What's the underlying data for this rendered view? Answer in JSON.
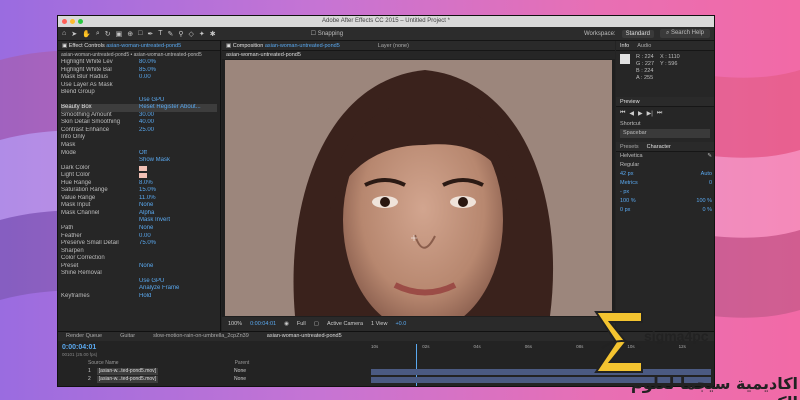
{
  "window": {
    "title": "Adobe After Effects CC 2015 – Untitled Project *"
  },
  "toolbar": {
    "snapping_label": "Snapping",
    "workspace_label": "Workspace:",
    "workspace_value": "Standard",
    "search_placeholder": "Search Help"
  },
  "effect_controls": {
    "tab_title": "Effect Controls",
    "tab_layer": "asian-woman-untreated-pond5",
    "subtitle": "asian-woman-untreated-pond5 • asian-woman-untreated-pond5",
    "rows": [
      {
        "label": "Highlight White Lev",
        "value": "80.0%"
      },
      {
        "label": "Highlight White Bal",
        "value": "85.0%"
      },
      {
        "label": "Mask Blur Radius",
        "value": "0.00"
      },
      {
        "label": "Use Layer As Mask",
        "value": ""
      },
      {
        "label": "Blend Group",
        "value": ""
      },
      {
        "label": "",
        "value": "Use GPU"
      },
      {
        "label": "Beauty Box",
        "value": "Reset   Register   About..."
      },
      {
        "label": "Smoothing Amount",
        "value": "30.00"
      },
      {
        "label": "Skin Detail Smoothing",
        "value": "40.00"
      },
      {
        "label": "Contrast Enhance",
        "value": "25.00"
      },
      {
        "label": "Info Only",
        "value": ""
      },
      {
        "label": "Mask",
        "value": ""
      },
      {
        "label": "Mode",
        "value": "Off"
      },
      {
        "label": "",
        "value": "Show Mask"
      },
      {
        "label": "Dark Color",
        "value": ""
      },
      {
        "label": "Light Color",
        "value": ""
      },
      {
        "label": "Hue Range",
        "value": "8.0%"
      },
      {
        "label": "Saturation Range",
        "value": "15.0%"
      },
      {
        "label": "Value Range",
        "value": "11.0%"
      },
      {
        "label": "Mask Input",
        "value": "None"
      },
      {
        "label": "Mask Channel",
        "value": "Alpha"
      },
      {
        "label": "",
        "value": "Mask Invert"
      },
      {
        "label": "Path",
        "value": "None"
      },
      {
        "label": "Feather",
        "value": "0.00"
      },
      {
        "label": "Preserve Small Detail",
        "value": "75.0%"
      },
      {
        "label": "Sharpen",
        "value": ""
      },
      {
        "label": "Color Correction",
        "value": ""
      },
      {
        "label": "Preset",
        "value": "None"
      },
      {
        "label": "Shine Removal",
        "value": ""
      },
      {
        "label": "",
        "value": "Use GPU"
      },
      {
        "label": "",
        "value": "Analyze Frame"
      },
      {
        "label": "Keyframes",
        "value": "Hold"
      }
    ]
  },
  "composition": {
    "tab_title": "Composition",
    "tab_name": "asian-woman-untreated-pond5",
    "layer_tab": "Layer (none)",
    "crumb": "asian-woman-untreated-pond5",
    "zoom": "100%",
    "timecode": "0:00:04:01",
    "resolution": "Full",
    "camera": "Active Camera",
    "view": "1 View",
    "exposure": "+0.0"
  },
  "info_panel": {
    "tab_info": "Info",
    "tab_audio": "Audio",
    "r": "R : 224",
    "g": "G : 227",
    "b": "B : 224",
    "a": "A : 255",
    "x": "X : 1110",
    "y": "Y : 596"
  },
  "preview_panel": {
    "title": "Preview",
    "shortcut_label": "Shortcut",
    "shortcut_value": "Spacebar"
  },
  "character_panel": {
    "tab_presets": "Presets",
    "tab_character": "Character",
    "font": "Helvetica",
    "style": "Regular",
    "size": "42 px",
    "leading": "Auto",
    "tracking_label": "Metrics",
    "tracking": "0",
    "stroke": "- px",
    "vscale": "100 %",
    "hscale": "100 %",
    "baseline": "0 px",
    "tsume": "0 %"
  },
  "timeline": {
    "tab_render": "Render Queue",
    "tab_guitar": "Guitar",
    "tab_comp2": "slow-motion-rain-on-umbrella_2cpZn39",
    "tab_comp": "asian-woman-untreated-pond5",
    "timecode": "0:00:04:01",
    "frames": "00101 (25.00 fps)",
    "ruler": [
      "10s",
      "02s",
      "04s",
      "06s",
      "08s",
      "10s",
      "12s"
    ],
    "source_header": "Source Name",
    "parent_header": "Parent",
    "layers": [
      {
        "index": "1",
        "name": "[asian-w...ted-pond5.mov]",
        "parent": "None"
      },
      {
        "index": "2",
        "name": "[asian-w...ted-pond5.mov]",
        "parent": "None"
      }
    ]
  },
  "watermark": {
    "brand": "sigma4pc",
    "arabic": "اكاديمية سيجما لعلوم الكمبيوتر"
  }
}
